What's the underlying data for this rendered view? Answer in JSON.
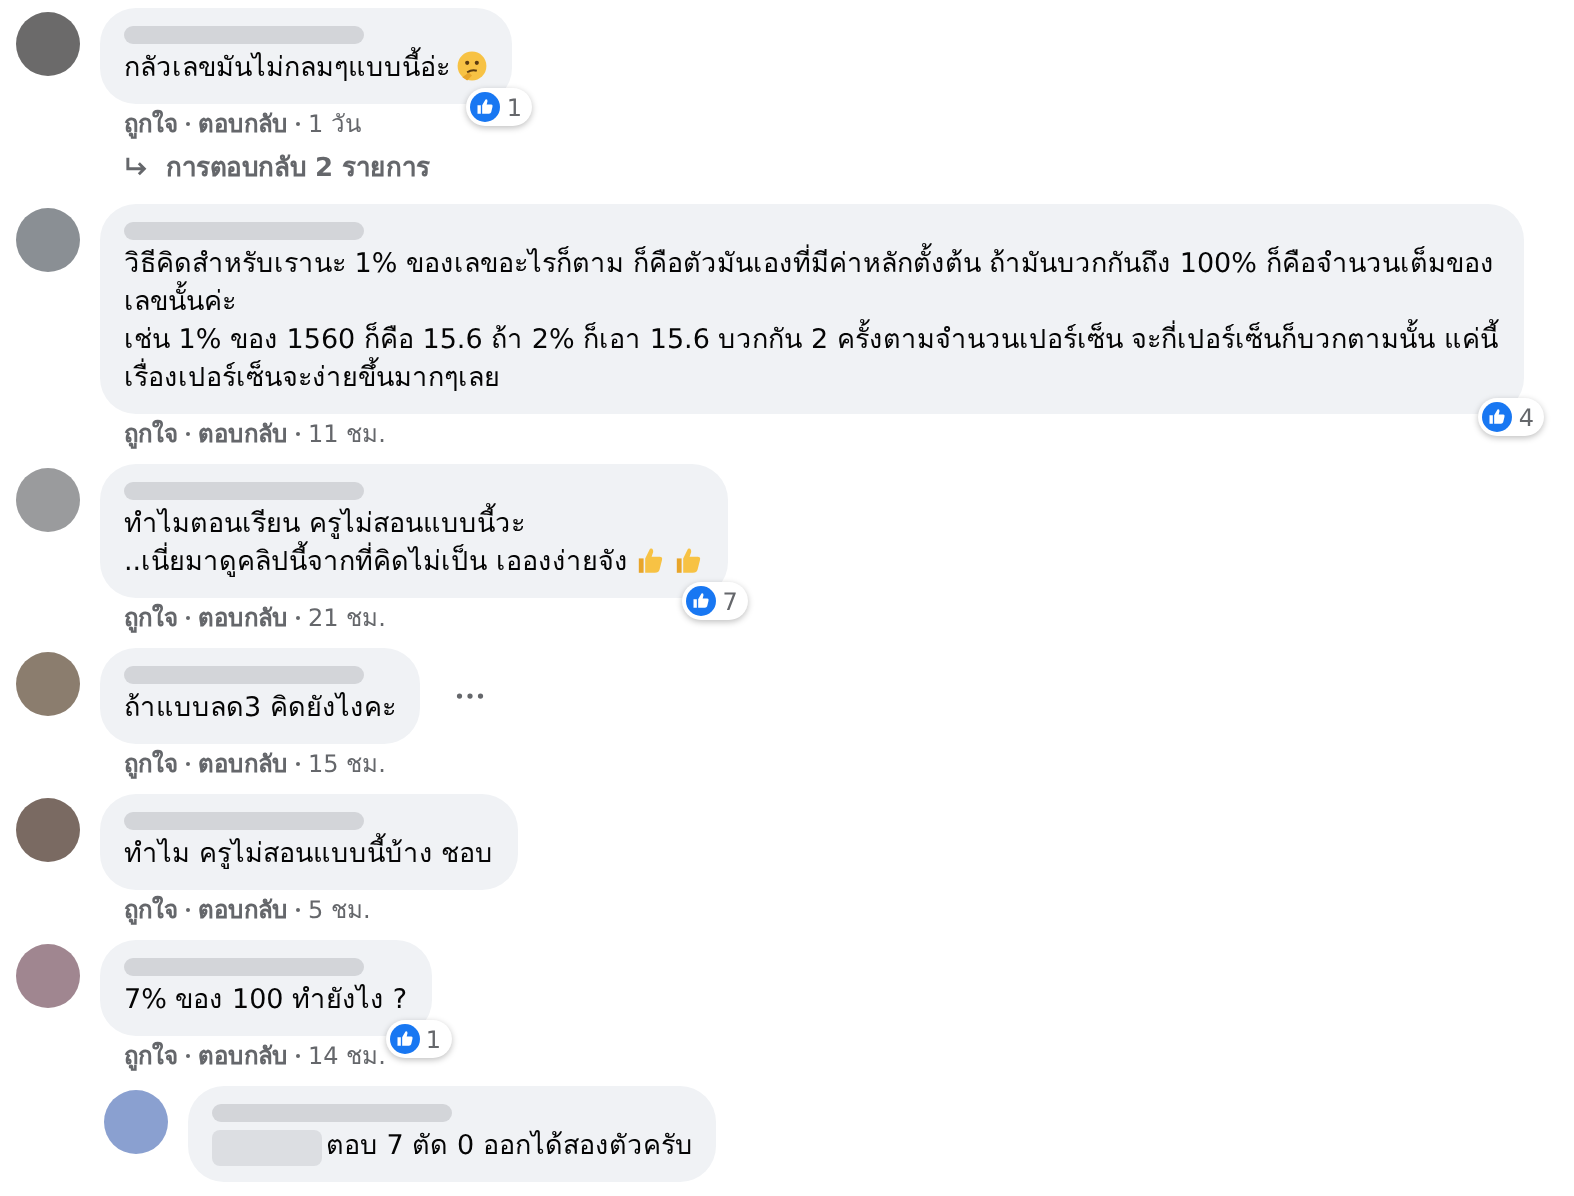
{
  "comments": [
    {
      "kind": "comment",
      "paragraphs": [
        "กลัวเลขมันไม่กลมๆแบบนี้อ่ะ"
      ],
      "trailing_icons": [
        {
          "kind": "thinking"
        }
      ],
      "reactions": "1",
      "like": "ถูกใจ",
      "reply": "ตอบกลับ",
      "time": "1 วัน",
      "replies_link": "การตอบกลับ 2 รายการ"
    },
    {
      "kind": "comment",
      "paragraphs": [
        "วิธีคิดสำหรับเรานะ 1% ของเลขอะไรก็ตาม ก็คือตัวมันเองที่มีค่าหลักตั้งต้น ถ้ามันบวกกันถึง 100% ก็คือจำนวนเต็มของเลขนั้นค่ะ",
        "เช่น 1% ของ 1560 ก็คือ 15.6 ถ้า 2% ก็เอา 15.6 บวกกัน 2 ครั้งตามจำนวนเปอร์เซ็น จะกี่เปอร์เซ็นก็บวกตามนั้น แค่นี้เรื่องเปอร์เซ็นจะง่ายขึ้นมากๆเลย"
      ],
      "reactions": "4",
      "like": "ถูกใจ",
      "reply": "ตอบกลับ",
      "time": "11 ชม."
    },
    {
      "kind": "comment",
      "paragraphs": [
        "ทำไมตอนเรียน ครูไม่สอนแบบนี้วะ",
        "..เนี่ยมาดูคลิปนี้จากที่คิดไม่เป็น เอองง่ายจัง"
      ],
      "trailing_icons": [
        {
          "kind": "thumbs_up"
        },
        {
          "kind": "thumbs_up"
        }
      ],
      "reactions": "7",
      "like": "ถูกใจ",
      "reply": "ตอบกลับ",
      "time": "21 ชม."
    },
    {
      "kind": "comment",
      "paragraphs": [
        "ถ้าแบบลด3 คิดยังไงคะ"
      ],
      "more_button": true,
      "like": "ถูกใจ",
      "reply": "ตอบกลับ",
      "time": "15 ชม."
    },
    {
      "kind": "comment",
      "paragraphs": [
        "ทำไม ครูไม่สอนแบบนี้บ้าง ชอบ"
      ],
      "like": "ถูกใจ",
      "reply": "ตอบกลับ",
      "time": "5 ชม."
    },
    {
      "kind": "comment",
      "paragraphs": [
        "7% ของ 100 ทำยังไง ?"
      ],
      "reactions": "1",
      "like": "ถูกใจ",
      "reply": "ตอบกลับ",
      "time": "14 ชม."
    },
    {
      "kind": "reply",
      "paragraphs": [
        "ตอบ 7 ตัด 0 ออกได้สองตัวครับ"
      ]
    }
  ]
}
